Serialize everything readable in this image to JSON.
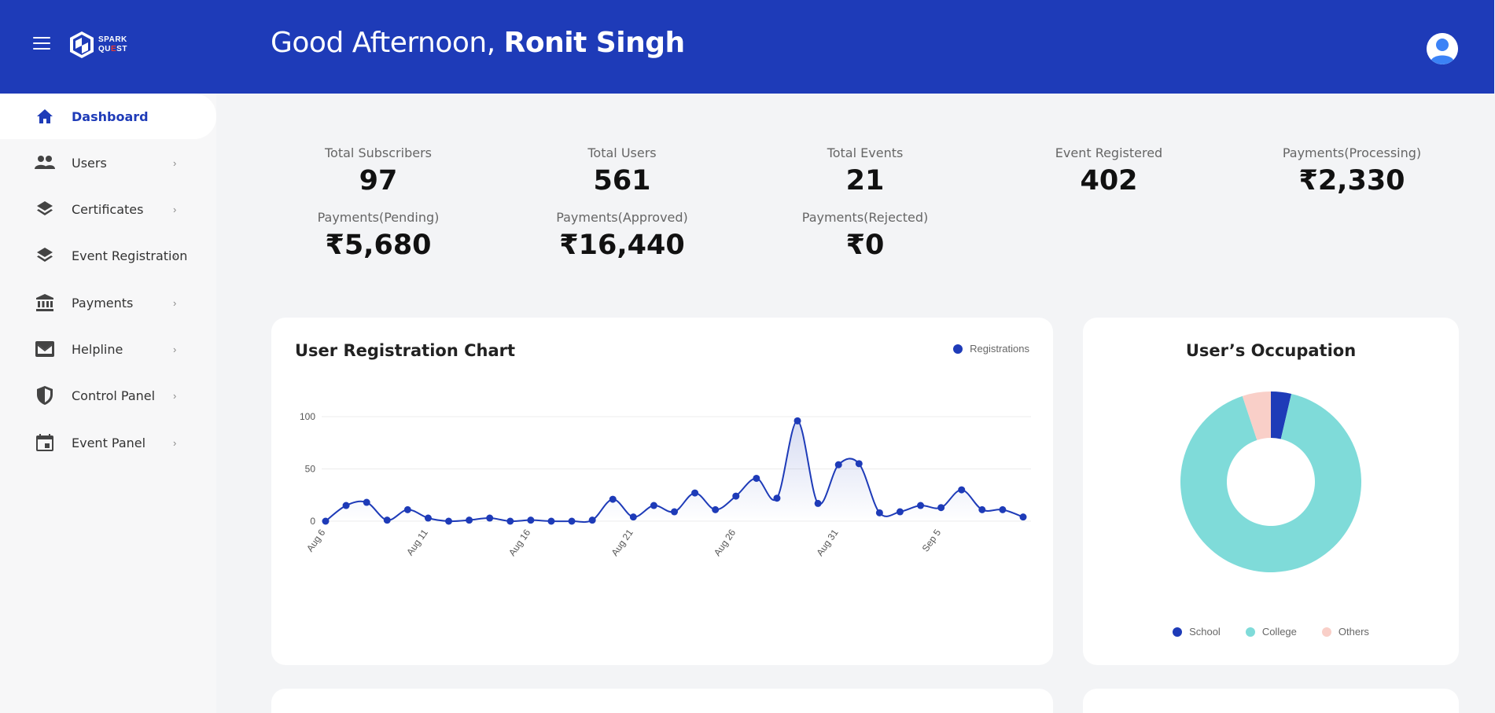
{
  "header": {
    "greeting_prefix": "Good Afternoon, ",
    "user_name": "Ronit Singh",
    "logo_line1": "SPARK",
    "logo_line2_a": "QU",
    "logo_line2_b": "E",
    "logo_line2_c": "ST"
  },
  "sidebar": {
    "items": [
      {
        "label": "Dashboard",
        "icon": "home-icon",
        "active": true
      },
      {
        "label": "Users",
        "icon": "users-icon"
      },
      {
        "label": "Certificates",
        "icon": "layers-icon"
      },
      {
        "label": "Event Registration",
        "icon": "layers-icon"
      },
      {
        "label": "Payments",
        "icon": "bank-icon"
      },
      {
        "label": "Helpline",
        "icon": "mail-icon"
      },
      {
        "label": "Control Panel",
        "icon": "shield-icon"
      },
      {
        "label": "Event Panel",
        "icon": "calendar-icon"
      }
    ],
    "chevron": "›"
  },
  "stats": {
    "total_subscribers": {
      "label": "Total Subscribers",
      "value": "97"
    },
    "total_users": {
      "label": "Total Users",
      "value": "561"
    },
    "total_events": {
      "label": "Total Events",
      "value": "21"
    },
    "event_registered": {
      "label": "Event Registered",
      "value": "402"
    },
    "payments_processing": {
      "label": "Payments(Processing)",
      "value": "₹2,330"
    },
    "payments_pending": {
      "label": "Payments(Pending)",
      "value": "₹5,680"
    },
    "payments_approved": {
      "label": "Payments(Approved)",
      "value": "₹16,440"
    },
    "payments_rejected": {
      "label": "Payments(Rejected)",
      "value": "₹0"
    }
  },
  "colors": {
    "brand": "#1e3bb8",
    "college": "#7fdbd9",
    "others": "#f9cfc8"
  },
  "chart_data": [
    {
      "type": "line",
      "title": "User Registration Chart",
      "series": [
        {
          "name": "Registrations",
          "values": [
            0,
            15,
            18,
            1,
            11,
            3,
            0,
            1,
            3,
            0,
            1,
            0,
            0,
            1,
            21,
            4,
            15,
            9,
            27,
            11,
            24,
            41,
            22,
            96,
            17,
            54,
            55,
            8,
            9,
            15,
            13,
            30,
            11,
            11,
            4
          ]
        }
      ],
      "x_tick_labels": [
        "Aug 6",
        "Aug 11",
        "Aug 16",
        "Aug 21",
        "Aug 26",
        "Aug 31",
        "Sep 5"
      ],
      "x_tick_index": [
        0,
        5,
        10,
        15,
        20,
        25,
        30
      ],
      "y_ticks": [
        "0",
        "50",
        "100"
      ],
      "ylim": [
        0,
        100
      ],
      "grid": true,
      "legend": "top-right"
    },
    {
      "type": "pie",
      "title": "User’s Occupation",
      "donut": true,
      "labels": [
        "School",
        "College",
        "Others"
      ],
      "values": [
        15,
        376,
        21
      ],
      "colors": [
        "#1e3bb8",
        "#7fdbd9",
        "#f9cfc8"
      ],
      "legend": "bottom"
    }
  ]
}
